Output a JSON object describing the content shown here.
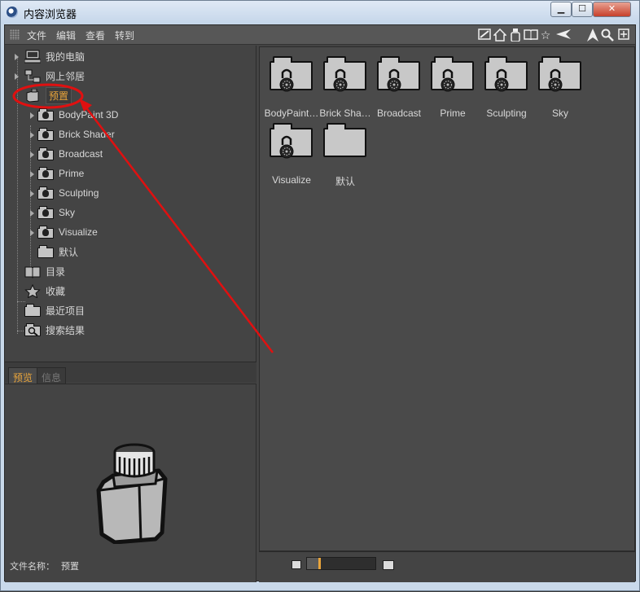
{
  "window": {
    "title": "内容浏览器",
    "controls": [
      "minimize",
      "maximize",
      "close"
    ]
  },
  "menu": {
    "items": [
      "文件",
      "编辑",
      "查看",
      "转到"
    ]
  },
  "toolbar": {
    "icons": [
      "edit-icon",
      "home-icon",
      "bottle-icon",
      "book-icon",
      "star-icon",
      "back-arrow-icon",
      "up-arrow-icon",
      "search-icon",
      "add-icon"
    ]
  },
  "tree": {
    "my_computer": "我的电脑",
    "network": "网上邻居",
    "presets": "预置",
    "children": [
      "BodyPaint 3D",
      "Brick Shader",
      "Broadcast",
      "Prime",
      "Sculpting",
      "Sky",
      "Visualize",
      "默认"
    ],
    "catalog": "目录",
    "favorites": "收藏",
    "recent": "最近项目",
    "search_results": "搜索结果"
  },
  "preview": {
    "tabs": [
      "预览",
      "信息"
    ],
    "active_tab": "预览",
    "file_name_label": "文件名称：",
    "file_name_value": "预置"
  },
  "content": {
    "items": [
      {
        "label": "BodyPaint…",
        "locked": true
      },
      {
        "label": "Brick Sha…",
        "locked": true
      },
      {
        "label": "Broadcast",
        "locked": true
      },
      {
        "label": "Prime",
        "locked": true
      },
      {
        "label": "Sculpting",
        "locked": true
      },
      {
        "label": "Sky",
        "locked": true
      },
      {
        "label": "Visualize",
        "locked": true
      },
      {
        "label": "默认",
        "locked": false
      }
    ]
  },
  "statusbar": {
    "zoom_fraction": 0.17
  },
  "colors": {
    "accent": "#e8a43b",
    "annotation": "#e01010",
    "panel_bg": "#444444"
  }
}
